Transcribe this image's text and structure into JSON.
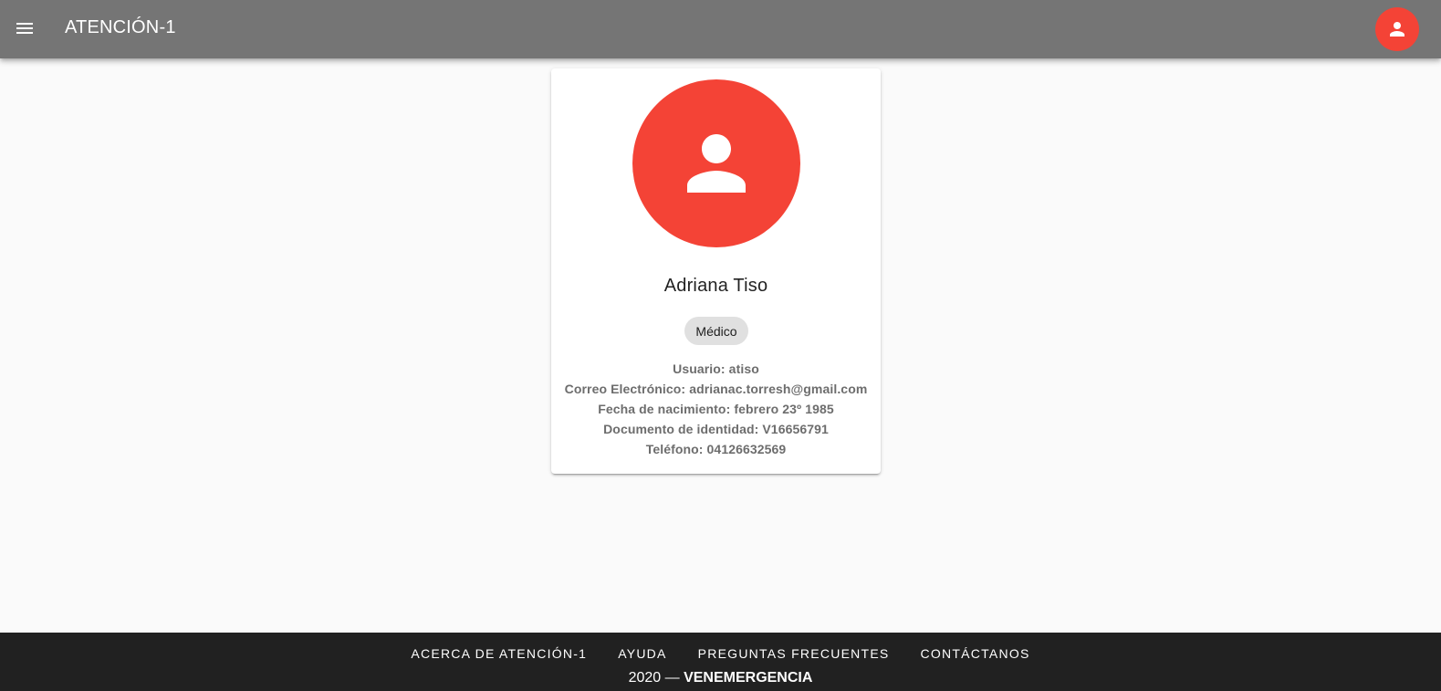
{
  "app_bar": {
    "title": "ATENCIÓN-1",
    "menu_icon": "menu-icon",
    "account_icon": "person-icon"
  },
  "colors": {
    "app_bar_bg": "#757575",
    "accent": "#f44336",
    "footer_bg": "#212121",
    "chip_bg": "#e0e0e0"
  },
  "profile": {
    "avatar_icon": "person-icon",
    "name": "Adriana Tiso",
    "role": "Médico",
    "details": [
      "Usuario: atiso",
      "Correo Electrónico: adrianac.torresh@gmail.com",
      "Fecha de nacimiento: febrero 23º 1985",
      "Documento de identidad: V16656791",
      "Teléfono: 04126632569"
    ]
  },
  "footer": {
    "links": [
      "ACERCA DE ATENCIÓN-1",
      "AYUDA",
      "PREGUNTAS FRECUENTES",
      "CONTÁCTANOS"
    ],
    "copyright_year": "2020 —",
    "copyright_brand": "VENEMERGENCIA"
  }
}
